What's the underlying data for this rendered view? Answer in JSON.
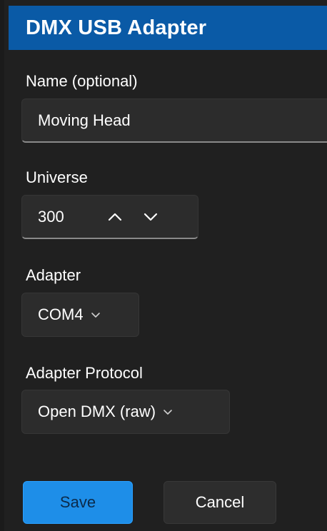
{
  "dialog": {
    "title": "DMX USB Adapter"
  },
  "name_field": {
    "label": "Name (optional)",
    "value": "Moving Head"
  },
  "universe_field": {
    "label": "Universe",
    "value": "300",
    "up_icon": "chevron-up-icon",
    "down_icon": "chevron-down-icon"
  },
  "adapter_field": {
    "label": "Adapter",
    "selected": "COM4",
    "icon": "chevron-down-icon"
  },
  "protocol_field": {
    "label": "Adapter Protocol",
    "selected": "Open DMX (raw)",
    "icon": "chevron-down-icon"
  },
  "buttons": {
    "save_label": "Save",
    "cancel_label": "Cancel"
  },
  "colors": {
    "title_bar": "#0a5aa6",
    "background": "#202020",
    "control": "#2c2c2c",
    "accent": "#1e8ee8"
  }
}
